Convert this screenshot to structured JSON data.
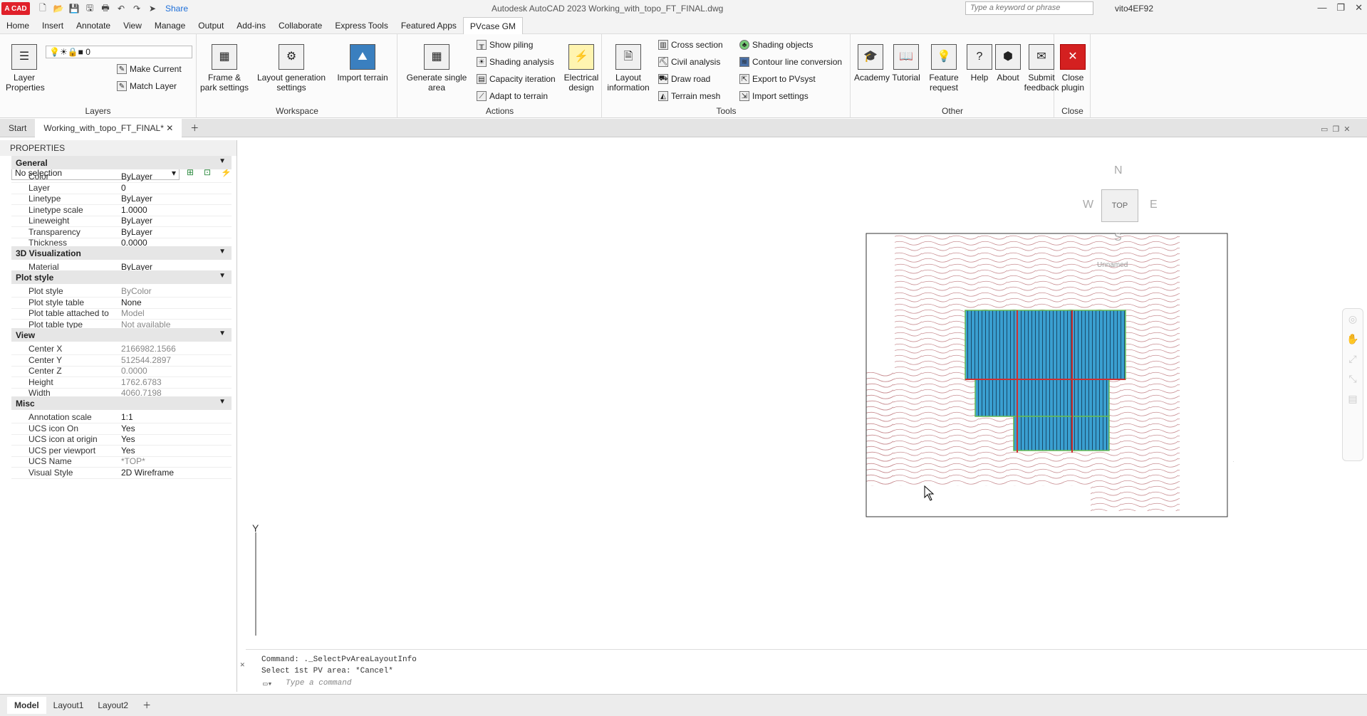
{
  "title": {
    "logo": "A CAD",
    "share": "Share",
    "app": "Autodesk AutoCAD 2023   Working_with_topo_FT_FINAL.dwg",
    "search_placeholder": "Type a keyword or phrase",
    "user": "vito4EF92"
  },
  "menu": [
    "Home",
    "Insert",
    "Annotate",
    "View",
    "Manage",
    "Output",
    "Add-ins",
    "Collaborate",
    "Express Tools",
    "Featured Apps",
    "PVcase GM"
  ],
  "ribbon": {
    "layers": {
      "layer_properties": "Layer Properties",
      "layer_value": "0",
      "make_current": "Make Current",
      "match_layer": "Match Layer",
      "label": "Layers"
    },
    "workspace": {
      "frame": "Frame & park settings",
      "layout_gen": "Layout generation settings",
      "import_terrain": "Import terrain",
      "label": "Workspace"
    },
    "actions": {
      "generate": "Generate single area",
      "show_piling": "Show piling",
      "shading_analysis": "Shading analysis",
      "capacity": "Capacity iteration",
      "adapt": "Adapt to terrain",
      "electrical": "Electrical design",
      "label": "Actions"
    },
    "tools": {
      "layout_info": "Layout information",
      "cross_section": "Cross section",
      "civil": "Civil analysis",
      "draw_road": "Draw road",
      "terrain_mesh": "Terrain mesh",
      "shading_objects": "Shading objects",
      "contour": "Contour line conversion",
      "export": "Export to PVsyst",
      "import_settings": "Import settings",
      "label": "Tools"
    },
    "other": {
      "academy": "Academy",
      "tutorial": "Tutorial",
      "feature": "Feature request",
      "help": "Help",
      "about": "About",
      "submit": "Submit feedback",
      "label": "Other"
    },
    "close": {
      "close_plugin": "Close plugin",
      "label": "Close"
    }
  },
  "doctabs": {
    "start": "Start",
    "file": "Working_with_topo_FT_FINAL*"
  },
  "properties": {
    "title": "PROPERTIES",
    "selection": "No selection",
    "sections": {
      "general": "General",
      "vis3d": "3D Visualization",
      "plot": "Plot style",
      "view": "View",
      "misc": "Misc"
    },
    "general": [
      [
        "Color",
        "ByLayer"
      ],
      [
        "Layer",
        "0"
      ],
      [
        "Linetype",
        "ByLayer"
      ],
      [
        "Linetype scale",
        "1.0000"
      ],
      [
        "Lineweight",
        "ByLayer"
      ],
      [
        "Transparency",
        "ByLayer"
      ],
      [
        "Thickness",
        "0.0000"
      ]
    ],
    "vis3d": [
      [
        "Material",
        "ByLayer"
      ]
    ],
    "plot": [
      [
        "Plot style",
        "ByColor"
      ],
      [
        "Plot style table",
        "None"
      ],
      [
        "Plot table attached to",
        "Model"
      ],
      [
        "Plot table type",
        "Not available"
      ]
    ],
    "view": [
      [
        "Center X",
        "2166982.1566"
      ],
      [
        "Center Y",
        "512544.2897"
      ],
      [
        "Center Z",
        "0.0000"
      ],
      [
        "Height",
        "1762.6783"
      ],
      [
        "Width",
        "4060.7198"
      ]
    ],
    "misc": [
      [
        "Annotation scale",
        "1:1"
      ],
      [
        "UCS icon On",
        "Yes"
      ],
      [
        "UCS icon at origin",
        "Yes"
      ],
      [
        "UCS per viewport",
        "Yes"
      ],
      [
        "UCS Name",
        "*TOP*"
      ],
      [
        "Visual Style",
        "2D Wireframe"
      ]
    ]
  },
  "viewcube": {
    "n": "N",
    "s": "S",
    "e": "E",
    "w": "W",
    "top": "TOP",
    "named": "Unnamed"
  },
  "ucs_y": "Y",
  "command": {
    "line1": "Command: ._SelectPvAreaLayoutInfo",
    "line2": "Select 1st PV area: *Cancel*",
    "placeholder": "Type a command"
  },
  "bottom": {
    "model": "Model",
    "layout1": "Layout1",
    "layout2": "Layout2"
  }
}
